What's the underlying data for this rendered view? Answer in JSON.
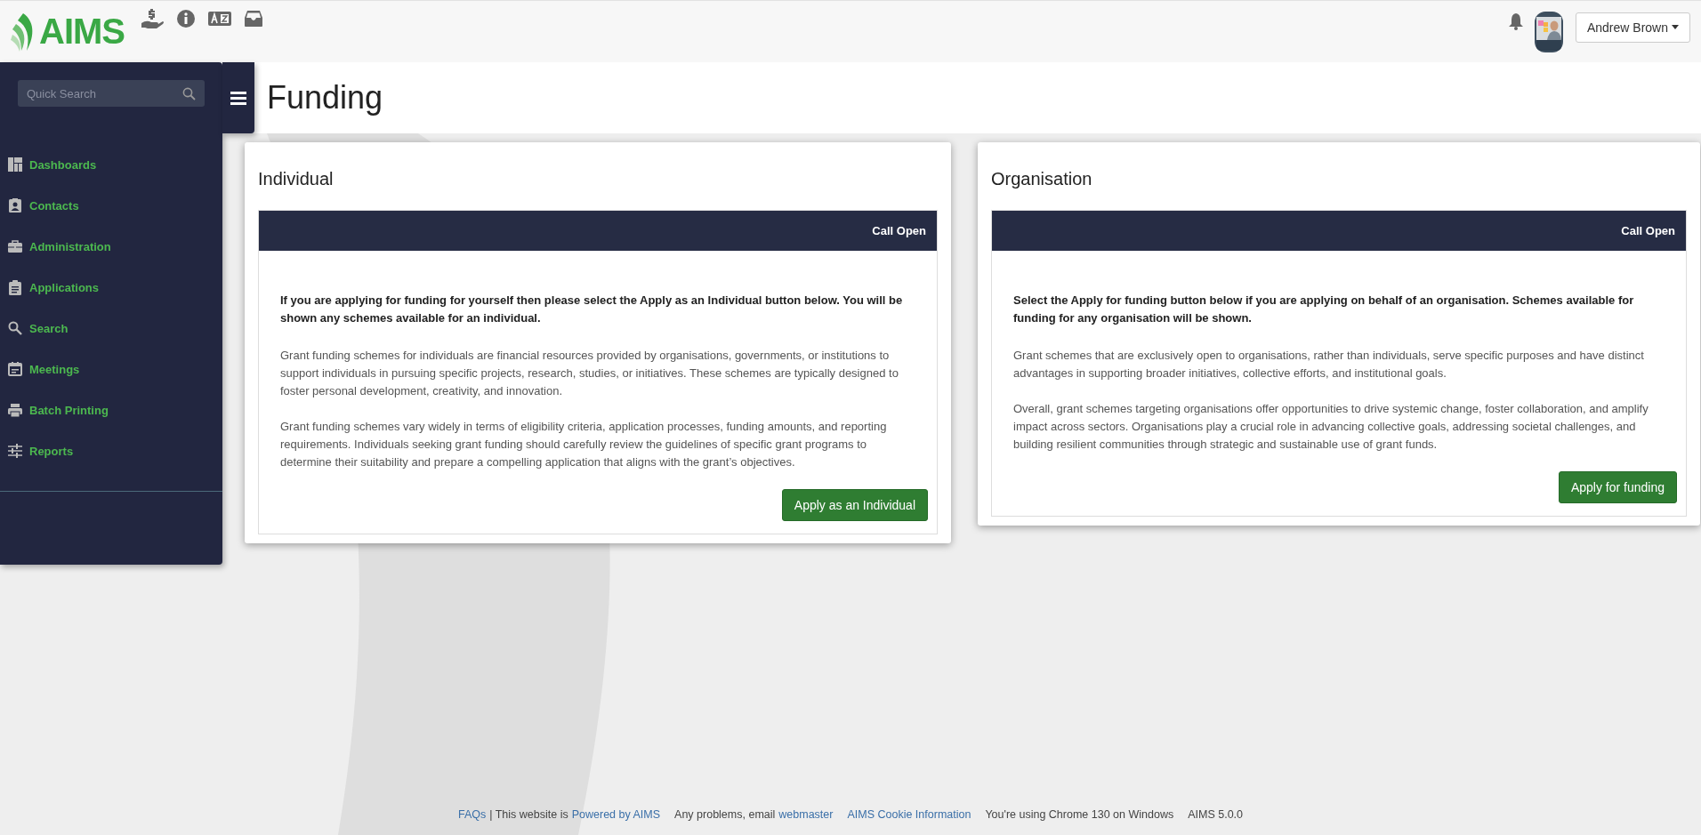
{
  "header": {
    "logo": "AIMS",
    "user": "Andrew Brown"
  },
  "sidebar": {
    "search": {
      "placeholder": "Quick Search"
    },
    "items": [
      {
        "label": "Dashboards"
      },
      {
        "label": "Contacts"
      },
      {
        "label": "Administration"
      },
      {
        "label": "Applications"
      },
      {
        "label": "Search"
      },
      {
        "label": "Meetings"
      },
      {
        "label": "Batch Printing"
      },
      {
        "label": "Reports"
      }
    ]
  },
  "page": {
    "title": "Funding"
  },
  "cards": [
    {
      "title": "Individual",
      "status": "Call Open",
      "intro": "If you are applying for funding for yourself then please select the Apply as an Individual button below. You will be shown any schemes available for an individual.",
      "paragraphs": [
        "Grant funding schemes for individuals are financial resources provided by organisations, governments, or institutions to support individuals in pursuing specific projects, research, studies, or initiatives. These schemes are typically designed to foster personal development, creativity, and innovation.",
        "Grant funding schemes vary widely in terms of eligibility criteria, application processes, funding amounts, and reporting requirements. Individuals seeking grant funding should carefully review the guidelines of specific grant programs to determine their suitability and prepare a compelling application that aligns with the grant’s objectives."
      ],
      "button": "Apply as an Individual"
    },
    {
      "title": "Organisation",
      "status": "Call Open",
      "intro": "Select the Apply for funding button below if you are applying on behalf of an organisation. Schemes available for funding for any organisation will be shown.",
      "paragraphs": [
        "Grant schemes that are exclusively open to organisations, rather than individuals, serve specific purposes and have distinct advantages in supporting broader initiatives, collective efforts, and institutional goals.",
        "Overall, grant schemes targeting organisations offer opportunities to drive systemic change, foster collaboration, and amplify impact across sectors. Organisations play a crucial role in advancing collective goals, addressing societal challenges, and building resilient communities through strategic and sustainable use of grant funds."
      ],
      "button": "Apply for funding"
    }
  ],
  "footer": [
    {
      "kind": "link",
      "text": "FAQs"
    },
    {
      "kind": "text",
      "text": "| This website is"
    },
    {
      "kind": "link",
      "text": "Powered by AIMS"
    },
    {
      "kind": "gap"
    },
    {
      "kind": "text",
      "text": "Any problems, email"
    },
    {
      "kind": "link",
      "text": "webmaster"
    },
    {
      "kind": "gap"
    },
    {
      "kind": "link",
      "text": "AIMS Cookie Information"
    },
    {
      "kind": "gap"
    },
    {
      "kind": "text",
      "text": "You're using Chrome 130 on Windows"
    },
    {
      "kind": "gap"
    },
    {
      "kind": "text",
      "text": "AIMS 5.0.0"
    }
  ]
}
